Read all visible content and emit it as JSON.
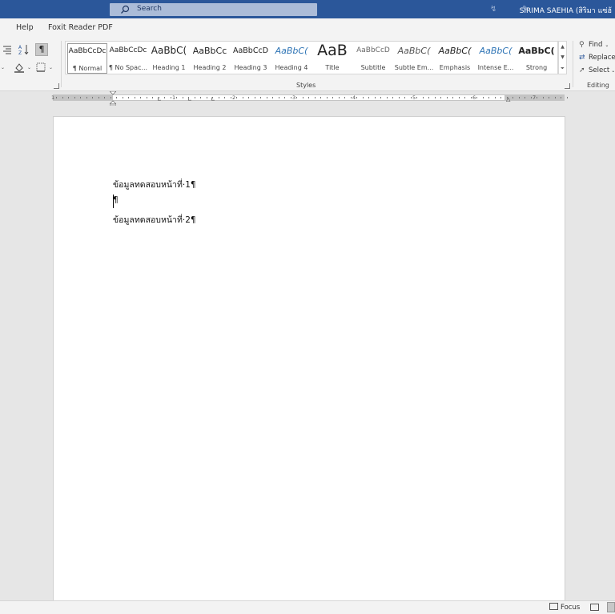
{
  "titlebar": {
    "search_label": "Search",
    "user_name": "SIRIMA SAEHIA (สิริมา แซ่ฮ้"
  },
  "tabs": [
    {
      "label": "Help"
    },
    {
      "label": "Foxit Reader PDF"
    }
  ],
  "ribbon": {
    "pilcrow": "¶",
    "styles": [
      {
        "preview": "AaBbCcDc",
        "label": "¶ Normal",
        "selected": true
      },
      {
        "preview": "AaBbCcDc",
        "label": "¶ No Spac..."
      },
      {
        "preview": "AaBbC(",
        "label": "Heading 1"
      },
      {
        "preview": "AaBbCc",
        "label": "Heading 2"
      },
      {
        "preview": "AaBbCcD",
        "label": "Heading 3"
      },
      {
        "preview": "AaBbC(",
        "label": "Heading 4"
      },
      {
        "preview": "AaB",
        "label": "Title"
      },
      {
        "preview": "AaBbCcD",
        "label": "Subtitle"
      },
      {
        "preview": "AaBbC(",
        "label": "Subtle Em..."
      },
      {
        "preview": "AaBbC(",
        "label": "Emphasis"
      },
      {
        "preview": "AaBbC(",
        "label": "Intense E..."
      },
      {
        "preview": "AaBbC(",
        "label": "Strong"
      }
    ],
    "styles_group_label": "Styles",
    "editing": {
      "find": "Find",
      "replace": "Replace",
      "select": "Select",
      "group_label": "Editing"
    }
  },
  "ruler": {
    "numbers": [
      "1",
      "1",
      "2",
      "3",
      "4",
      "5",
      "6",
      "7"
    ]
  },
  "document": {
    "paragraphs": [
      "ข้อมูลทดสอบหน้าที่·1¶",
      "¶",
      "ข้อมูลทดสอบหน้าที่·2¶"
    ]
  },
  "statusbar": {
    "focus": "Focus"
  },
  "colors": {
    "titlebar": "#2b579a",
    "ribbon": "#f3f3f3",
    "heading_blue": "#2e74b5"
  }
}
